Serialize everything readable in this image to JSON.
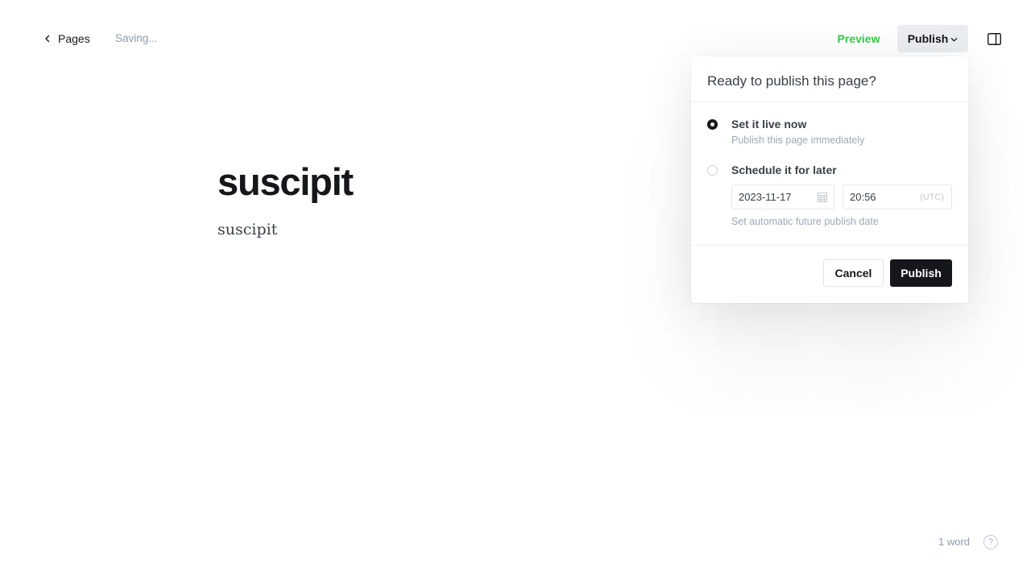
{
  "header": {
    "back_label": "Pages",
    "status_text": "Saving...",
    "preview_label": "Preview",
    "publish_label": "Publish"
  },
  "editor": {
    "title": "suscipit",
    "body": "suscipit"
  },
  "publish_panel": {
    "title": "Ready to publish this page?",
    "options": [
      {
        "label": "Set it live now",
        "description": "Publish this page immediately",
        "selected": true
      },
      {
        "label": "Schedule it for later",
        "description": "Set automatic future publish date",
        "selected": false
      }
    ],
    "schedule": {
      "date": "2023-11-17",
      "time": "20:56",
      "timezone": "(UTC)"
    },
    "cancel_label": "Cancel",
    "confirm_label": "Publish"
  },
  "footer": {
    "word_count": "1 word",
    "help_symbol": "?"
  },
  "colors": {
    "accent_green": "#30cf43",
    "text_dark": "#15171a",
    "muted": "#8e9cac"
  }
}
